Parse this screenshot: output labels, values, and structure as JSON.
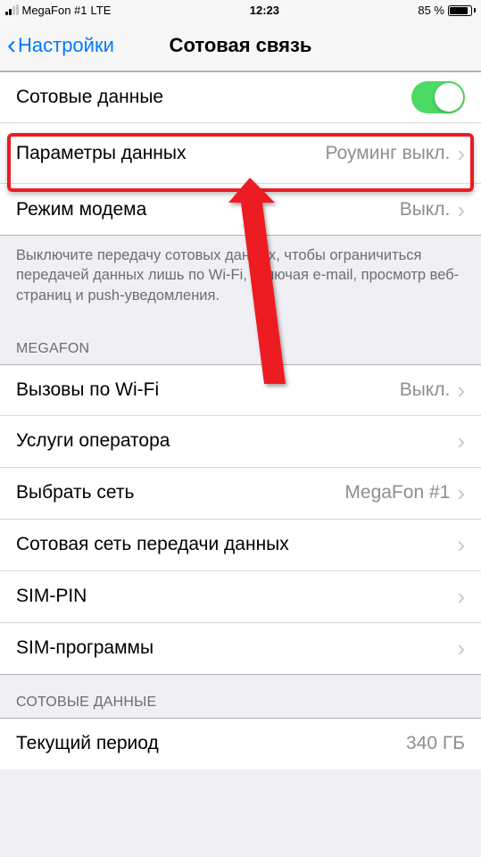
{
  "status": {
    "carrier": "MegaFon #1",
    "network": "LTE",
    "time": "12:23",
    "battery_pct": "85 %"
  },
  "nav": {
    "back": "Настройки",
    "title": "Сотовая связь"
  },
  "rows": {
    "cellular_data": "Сотовые данные",
    "data_options": {
      "label": "Параметры данных",
      "value": "Роуминг выкл."
    },
    "hotspot": {
      "label": "Режим модема",
      "value": "Выкл."
    }
  },
  "footer1": "Выключите передачу сотовых данных, чтобы ограничиться передачей данных лишь по Wi-Fi, включая e-mail, просмотр веб-страниц и push-уведомления.",
  "group_megafon": "MEGAFON",
  "megafon_rows": {
    "wifi_calling": {
      "label": "Вызовы по Wi-Fi",
      "value": "Выкл."
    },
    "carrier_services": "Услуги оператора",
    "select_network": {
      "label": "Выбрать сеть",
      "value": "MegaFon #1"
    },
    "cellular_network": "Сотовая сеть передачи данных",
    "sim_pin": "SIM-PIN",
    "sim_apps": "SIM-программы"
  },
  "group_cellular_data": "СОТОВЫЕ ДАННЫЕ",
  "usage_rows": {
    "current_period": {
      "label": "Текущий период",
      "value": "340 ГБ"
    }
  }
}
